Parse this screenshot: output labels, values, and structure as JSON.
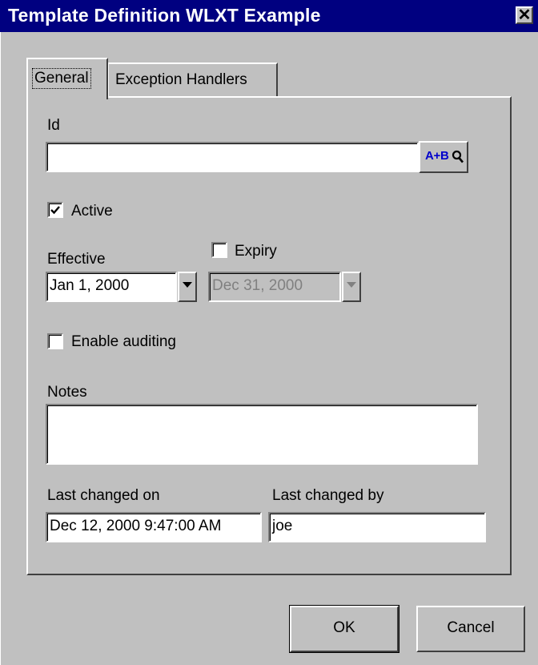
{
  "window": {
    "title": "Template Definition WLXT Example",
    "close_glyph": "✕"
  },
  "tabs": [
    {
      "label": "General",
      "selected": true
    },
    {
      "label": "Exception Handlers",
      "selected": false
    }
  ],
  "form": {
    "id": {
      "label": "Id",
      "value": "",
      "lookup_button_text": "A+B",
      "lookup_icon": "magnifier-icon"
    },
    "active": {
      "label": "Active",
      "checked": true
    },
    "effective": {
      "label": "Effective",
      "value": "Jan 1, 2000"
    },
    "expiry": {
      "label": "Expiry",
      "checked": false,
      "value": "Dec 31, 2000",
      "disabled": true
    },
    "enable_auditing": {
      "label": "Enable auditing",
      "checked": false
    },
    "notes": {
      "label": "Notes",
      "value": ""
    },
    "last_changed_on": {
      "label": "Last changed on",
      "value": "Dec 12, 2000 9:47:00 AM"
    },
    "last_changed_by": {
      "label": "Last changed by",
      "value": "joe"
    }
  },
  "buttons": {
    "ok": "OK",
    "cancel": "Cancel"
  },
  "colors": {
    "titlebar": "#000080",
    "face": "#c0c0c0",
    "lookup_text": "#0000cc",
    "disabled_text": "#808080"
  }
}
